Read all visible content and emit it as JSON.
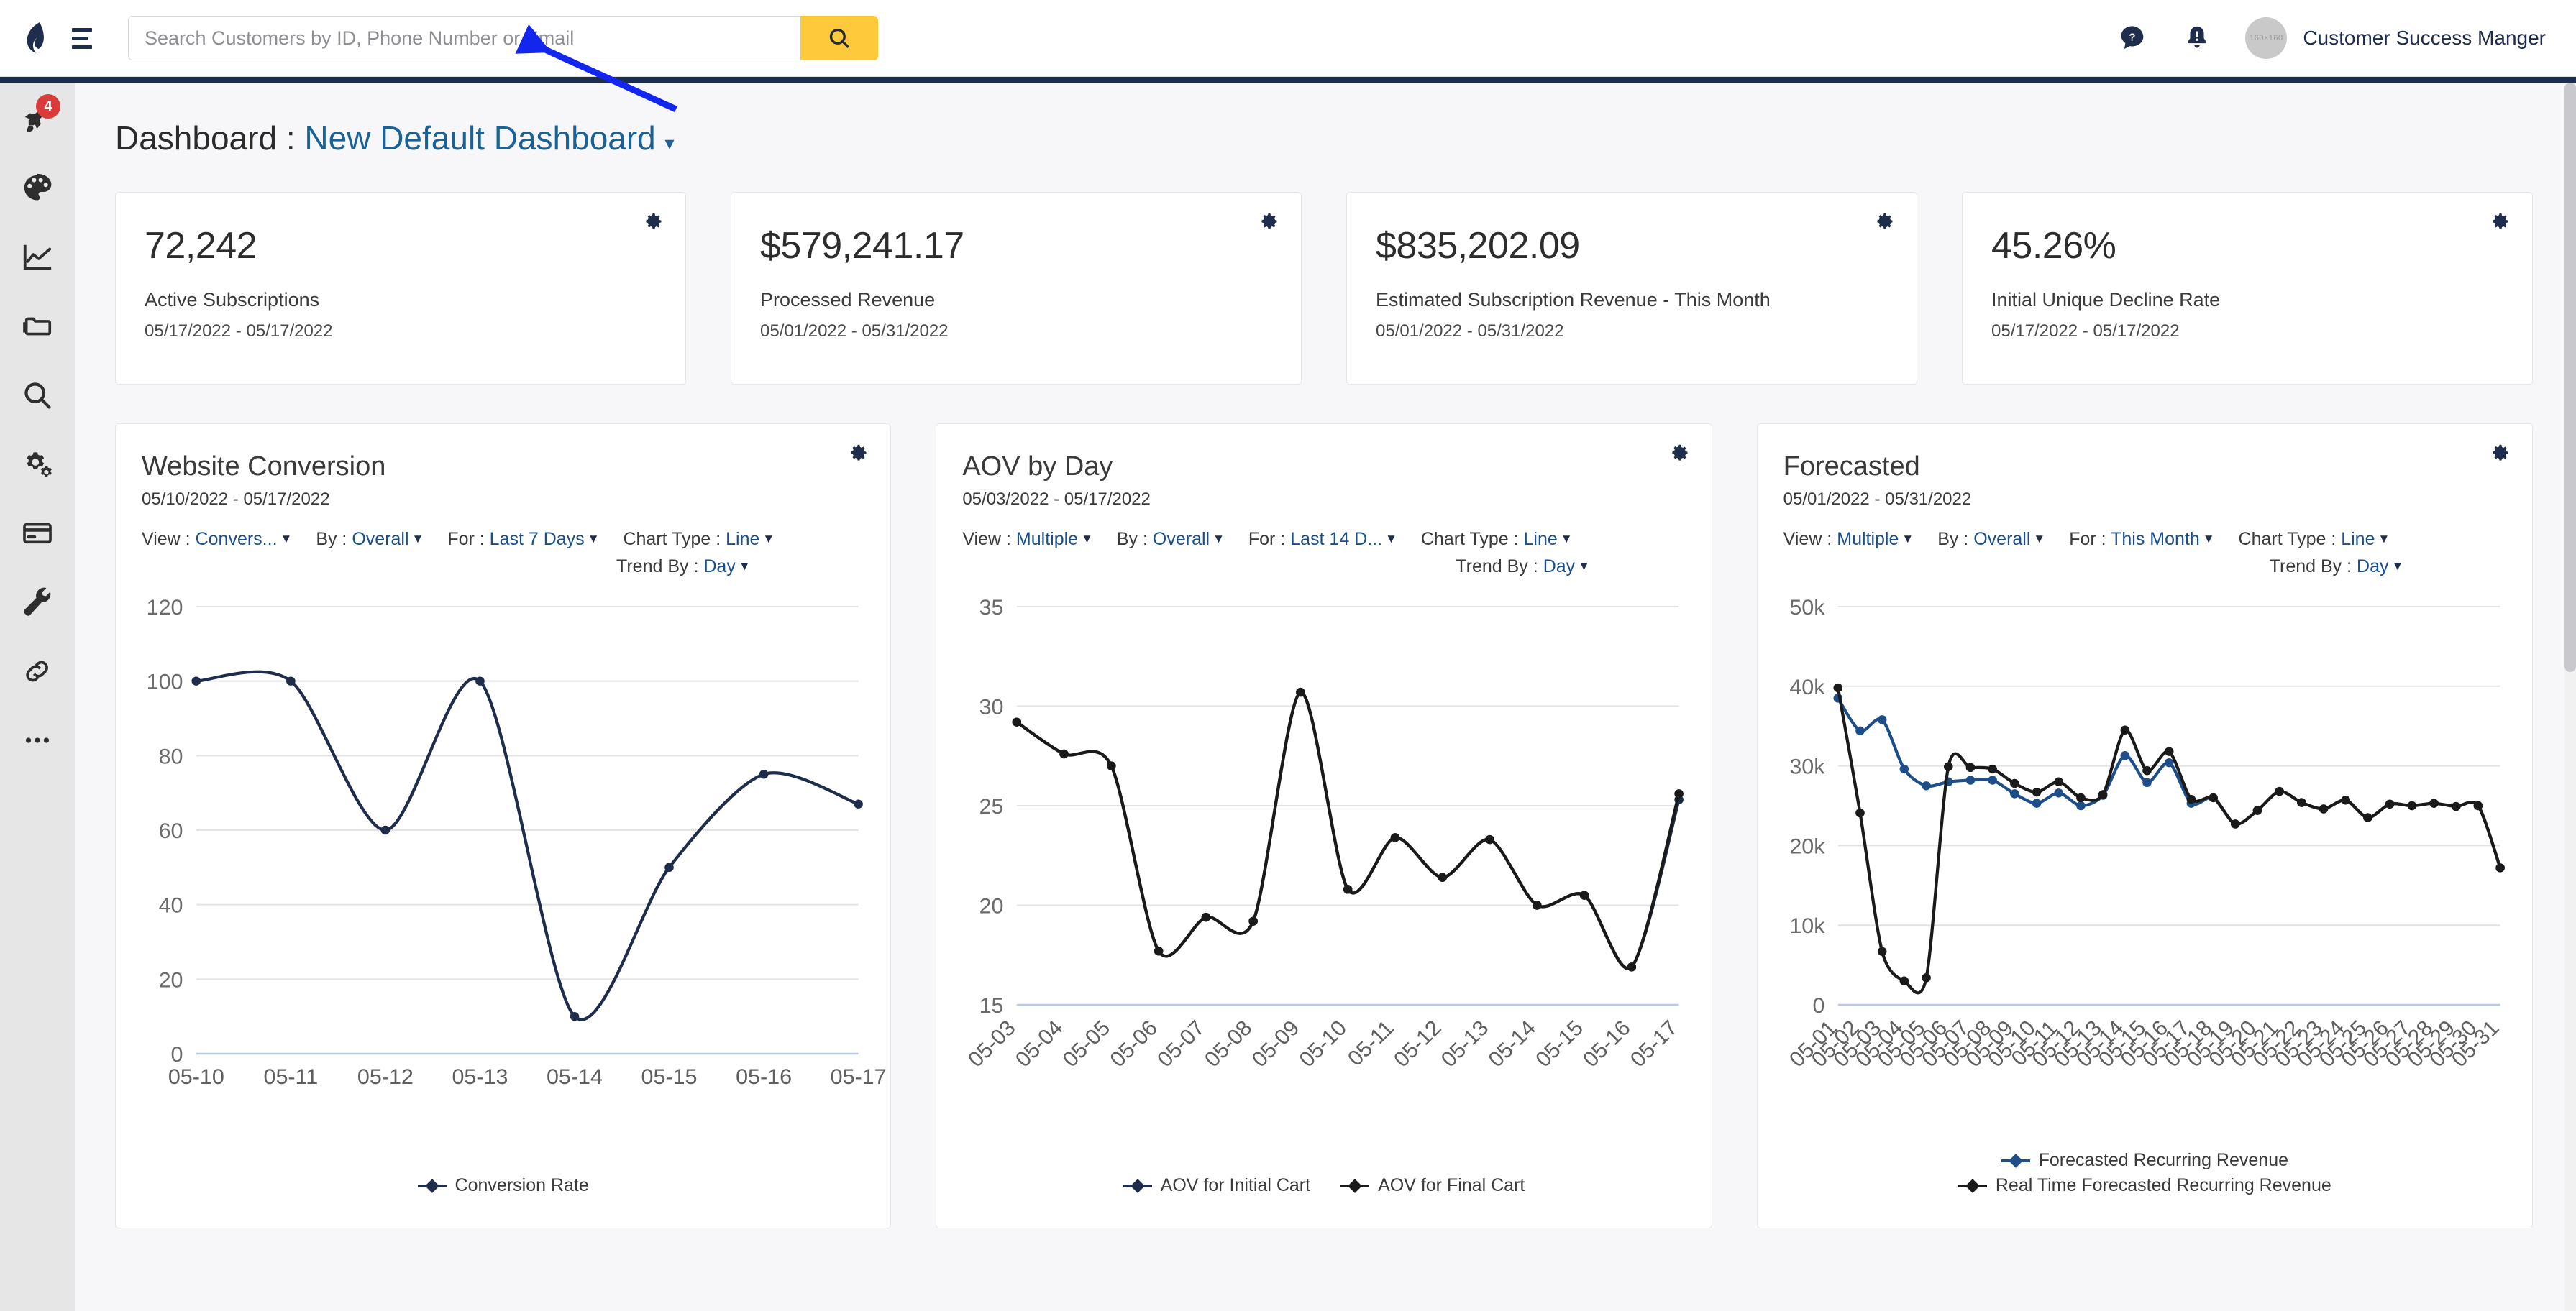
{
  "topbar": {
    "logo_icon": "lawpay-logo-icon",
    "menu_icon": "hamburger-menu-icon",
    "search": {
      "placeholder": "Search Customers by ID, Phone Number or Email",
      "value": "",
      "button_icon": "search-icon",
      "button_color": "#ffc93c"
    },
    "help_icon": "help-chat-icon",
    "notification_icon": "notification-bell-icon",
    "avatar_label": "160×160",
    "username": "Customer Success Manger"
  },
  "sidebar": {
    "items": [
      {
        "icon": "rocket-icon",
        "badge": "4"
      },
      {
        "icon": "palette-icon",
        "badge": ""
      },
      {
        "icon": "chart-line-icon",
        "badge": ""
      },
      {
        "icon": "folder-icon",
        "badge": ""
      },
      {
        "icon": "search-icon",
        "badge": ""
      },
      {
        "icon": "gears-icon",
        "badge": ""
      },
      {
        "icon": "credit-card-icon",
        "badge": ""
      },
      {
        "icon": "wrench-icon",
        "badge": ""
      },
      {
        "icon": "link-icon",
        "badge": ""
      },
      {
        "icon": "ellipsis-icon",
        "badge": ""
      }
    ]
  },
  "page": {
    "title_prefix": "Dashboard :",
    "title_name": "New Default Dashboard",
    "title_caret": "▾"
  },
  "kpis": [
    {
      "value": "72,242",
      "label": "Active Subscriptions",
      "range": "05/17/2022 - 05/17/2022",
      "gear_icon": "gear-icon"
    },
    {
      "value": "$579,241.17",
      "label": "Processed Revenue",
      "range": "05/01/2022 - 05/31/2022",
      "gear_icon": "gear-icon"
    },
    {
      "value": "$835,202.09",
      "label": "Estimated Subscription Revenue - This Month",
      "range": "05/01/2022 - 05/31/2022",
      "gear_icon": "gear-icon"
    },
    {
      "value": "45.26%",
      "label": "Initial Unique Decline Rate",
      "range": "05/17/2022 - 05/17/2022",
      "gear_icon": "gear-icon"
    }
  ],
  "charts": [
    {
      "title": "Website Conversion",
      "range": "05/10/2022 - 05/17/2022",
      "gear_icon": "gear-icon",
      "filters": {
        "view_label": "View :",
        "view_value": "Convers...",
        "by_label": "By :",
        "by_value": "Overall",
        "for_label": "For :",
        "for_value": "Last 7 Days",
        "type_label": "Chart Type :",
        "type_value": "Line",
        "trend_label": "Trend By :",
        "trend_value": "Day"
      }
    },
    {
      "title": "AOV by Day",
      "range": "05/03/2022 - 05/17/2022",
      "gear_icon": "gear-icon",
      "filters": {
        "view_label": "View :",
        "view_value": "Multiple",
        "by_label": "By :",
        "by_value": "Overall",
        "for_label": "For :",
        "for_value": "Last 14 D...",
        "type_label": "Chart Type :",
        "type_value": "Line",
        "trend_label": "Trend By :",
        "trend_value": "Day"
      }
    },
    {
      "title": "Forecasted",
      "range": "05/01/2022 - 05/31/2022",
      "gear_icon": "gear-icon",
      "filters": {
        "view_label": "View :",
        "view_value": "Multiple",
        "by_label": "By :",
        "by_value": "Overall",
        "for_label": "For :",
        "for_value": "This Month",
        "type_label": "Chart Type :",
        "type_value": "Line",
        "trend_label": "Trend By :",
        "trend_value": "Day"
      }
    }
  ],
  "chart_data": [
    {
      "type": "line",
      "title": "Website Conversion",
      "xlabel": "",
      "ylabel": "",
      "ylim": [
        0,
        120
      ],
      "yticks": [
        0,
        20,
        40,
        60,
        80,
        100,
        120
      ],
      "grid": true,
      "legend_position": "bottom",
      "categories": [
        "05-10",
        "05-11",
        "05-12",
        "05-13",
        "05-14",
        "05-15",
        "05-16",
        "05-17"
      ],
      "series": [
        {
          "name": "Conversion Rate",
          "color": "#1d2d4b",
          "values": [
            100,
            100,
            60,
            100,
            10,
            50,
            75,
            67
          ]
        }
      ]
    },
    {
      "type": "line",
      "title": "AOV by Day",
      "xlabel": "",
      "ylabel": "",
      "ylim": [
        15,
        35
      ],
      "yticks": [
        15,
        20,
        25,
        30,
        35
      ],
      "grid": true,
      "legend_position": "bottom",
      "categories": [
        "05-03",
        "05-04",
        "05-05",
        "05-06",
        "05-07",
        "05-08",
        "05-09",
        "05-10",
        "05-11",
        "05-12",
        "05-13",
        "05-14",
        "05-15",
        "05-16",
        "05-17"
      ],
      "series": [
        {
          "name": "AOV for Initial Cart",
          "color": "#1d2d4b",
          "values": [
            29.2,
            27.6,
            27.0,
            17.7,
            19.4,
            19.2,
            30.7,
            20.8,
            23.4,
            21.4,
            23.3,
            20.0,
            20.5,
            16.9,
            25.3
          ]
        },
        {
          "name": "AOV for Final Cart",
          "color": "#1a1a1a",
          "values": [
            29.2,
            27.6,
            27.0,
            17.7,
            19.4,
            19.2,
            30.7,
            20.8,
            23.4,
            21.4,
            23.3,
            20.0,
            20.5,
            16.9,
            25.6
          ]
        }
      ]
    },
    {
      "type": "line",
      "title": "Forecasted",
      "xlabel": "",
      "ylabel": "",
      "ylim": [
        0,
        50000
      ],
      "yticks": [
        0,
        10000,
        20000,
        30000,
        40000,
        50000
      ],
      "ytick_labels": [
        "0",
        "10k",
        "20k",
        "30k",
        "40k",
        "50k"
      ],
      "grid": true,
      "legend_position": "bottom",
      "categories": [
        "05-01",
        "05-02",
        "05-03",
        "05-04",
        "05-05",
        "05-06",
        "05-07",
        "05-08",
        "05-09",
        "05-10",
        "05-11",
        "05-12",
        "05-13",
        "05-14",
        "05-15",
        "05-16",
        "05-17",
        "05-18",
        "05-19",
        "05-20",
        "05-21",
        "05-22",
        "05-23",
        "05-24",
        "05-25",
        "05-26",
        "05-27",
        "05-28",
        "05-29",
        "05-30",
        "05-31"
      ],
      "series": [
        {
          "name": "Forecasted Recurring Revenue",
          "color": "#1d4e89",
          "values": [
            38500,
            34400,
            35800,
            29600,
            27500,
            28000,
            28200,
            28200,
            26500,
            25300,
            26600,
            25000,
            26300,
            31300,
            27900,
            30400,
            25300,
            26000,
            22700,
            24400,
            26800,
            25400,
            24600,
            25700,
            23500,
            25200,
            25000,
            25300,
            24900,
            25000,
            17200
          ]
        },
        {
          "name": "Real Time Forecasted Recurring Revenue",
          "color": "#1a1a1a",
          "values": [
            39800,
            24100,
            6700,
            3000,
            3400,
            29900,
            29800,
            29600,
            27800,
            26700,
            28000,
            26000,
            26400,
            34500,
            29400,
            31800,
            25800,
            26000,
            22700,
            24400,
            26800,
            25400,
            24600,
            25700,
            23500,
            25200,
            25000,
            25300,
            24900,
            25000,
            17200
          ]
        }
      ]
    }
  ],
  "annotation": {
    "arrow_color": "#1226ee",
    "arrow_target": "search-input"
  }
}
